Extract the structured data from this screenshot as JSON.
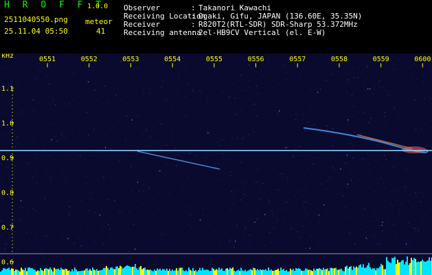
{
  "header": {
    "app_name": "H R O F F T",
    "app_version": "1.0.0",
    "file_name": "2511040550.png",
    "obs_label": "meteor",
    "obs_count": "41",
    "timestamp": "25.11.04 05:50",
    "info": [
      {
        "key": "Observer",
        "sep": ":",
        "value": "Takanori Kawachi"
      },
      {
        "key": "Receiving Location",
        "sep": ":",
        "value": "Ogaki, Gifu, JAPAN (136.60E, 35.35N)"
      },
      {
        "key": "Receiver",
        "sep": ":",
        "value": "R820T2(RTL-SDR) SDR-Sharp 53.372MHz"
      },
      {
        "key": "Receiving antenna",
        "sep": ":",
        "value": "2el-HB9CV Vertical (el. E-W)"
      }
    ]
  },
  "spectrogram": {
    "y_unit": "kHz",
    "y_ticks": [
      "1.1",
      "1.0",
      "0.9",
      "0.8",
      "0.7",
      "0.6"
    ],
    "x_ticks": [
      "0551",
      "0552",
      "0553",
      "0554",
      "0555",
      "0556",
      "0557",
      "0558",
      "0559",
      "0600"
    ],
    "carrier_freq_khz": 0.92,
    "colors": {
      "background": "#0a0a2e",
      "carrier": "#7fd8ff",
      "label": "#ffff00",
      "grid": "#ffff00",
      "band_bar": "#00e5ff",
      "band_peak": "#ffff00"
    }
  }
}
